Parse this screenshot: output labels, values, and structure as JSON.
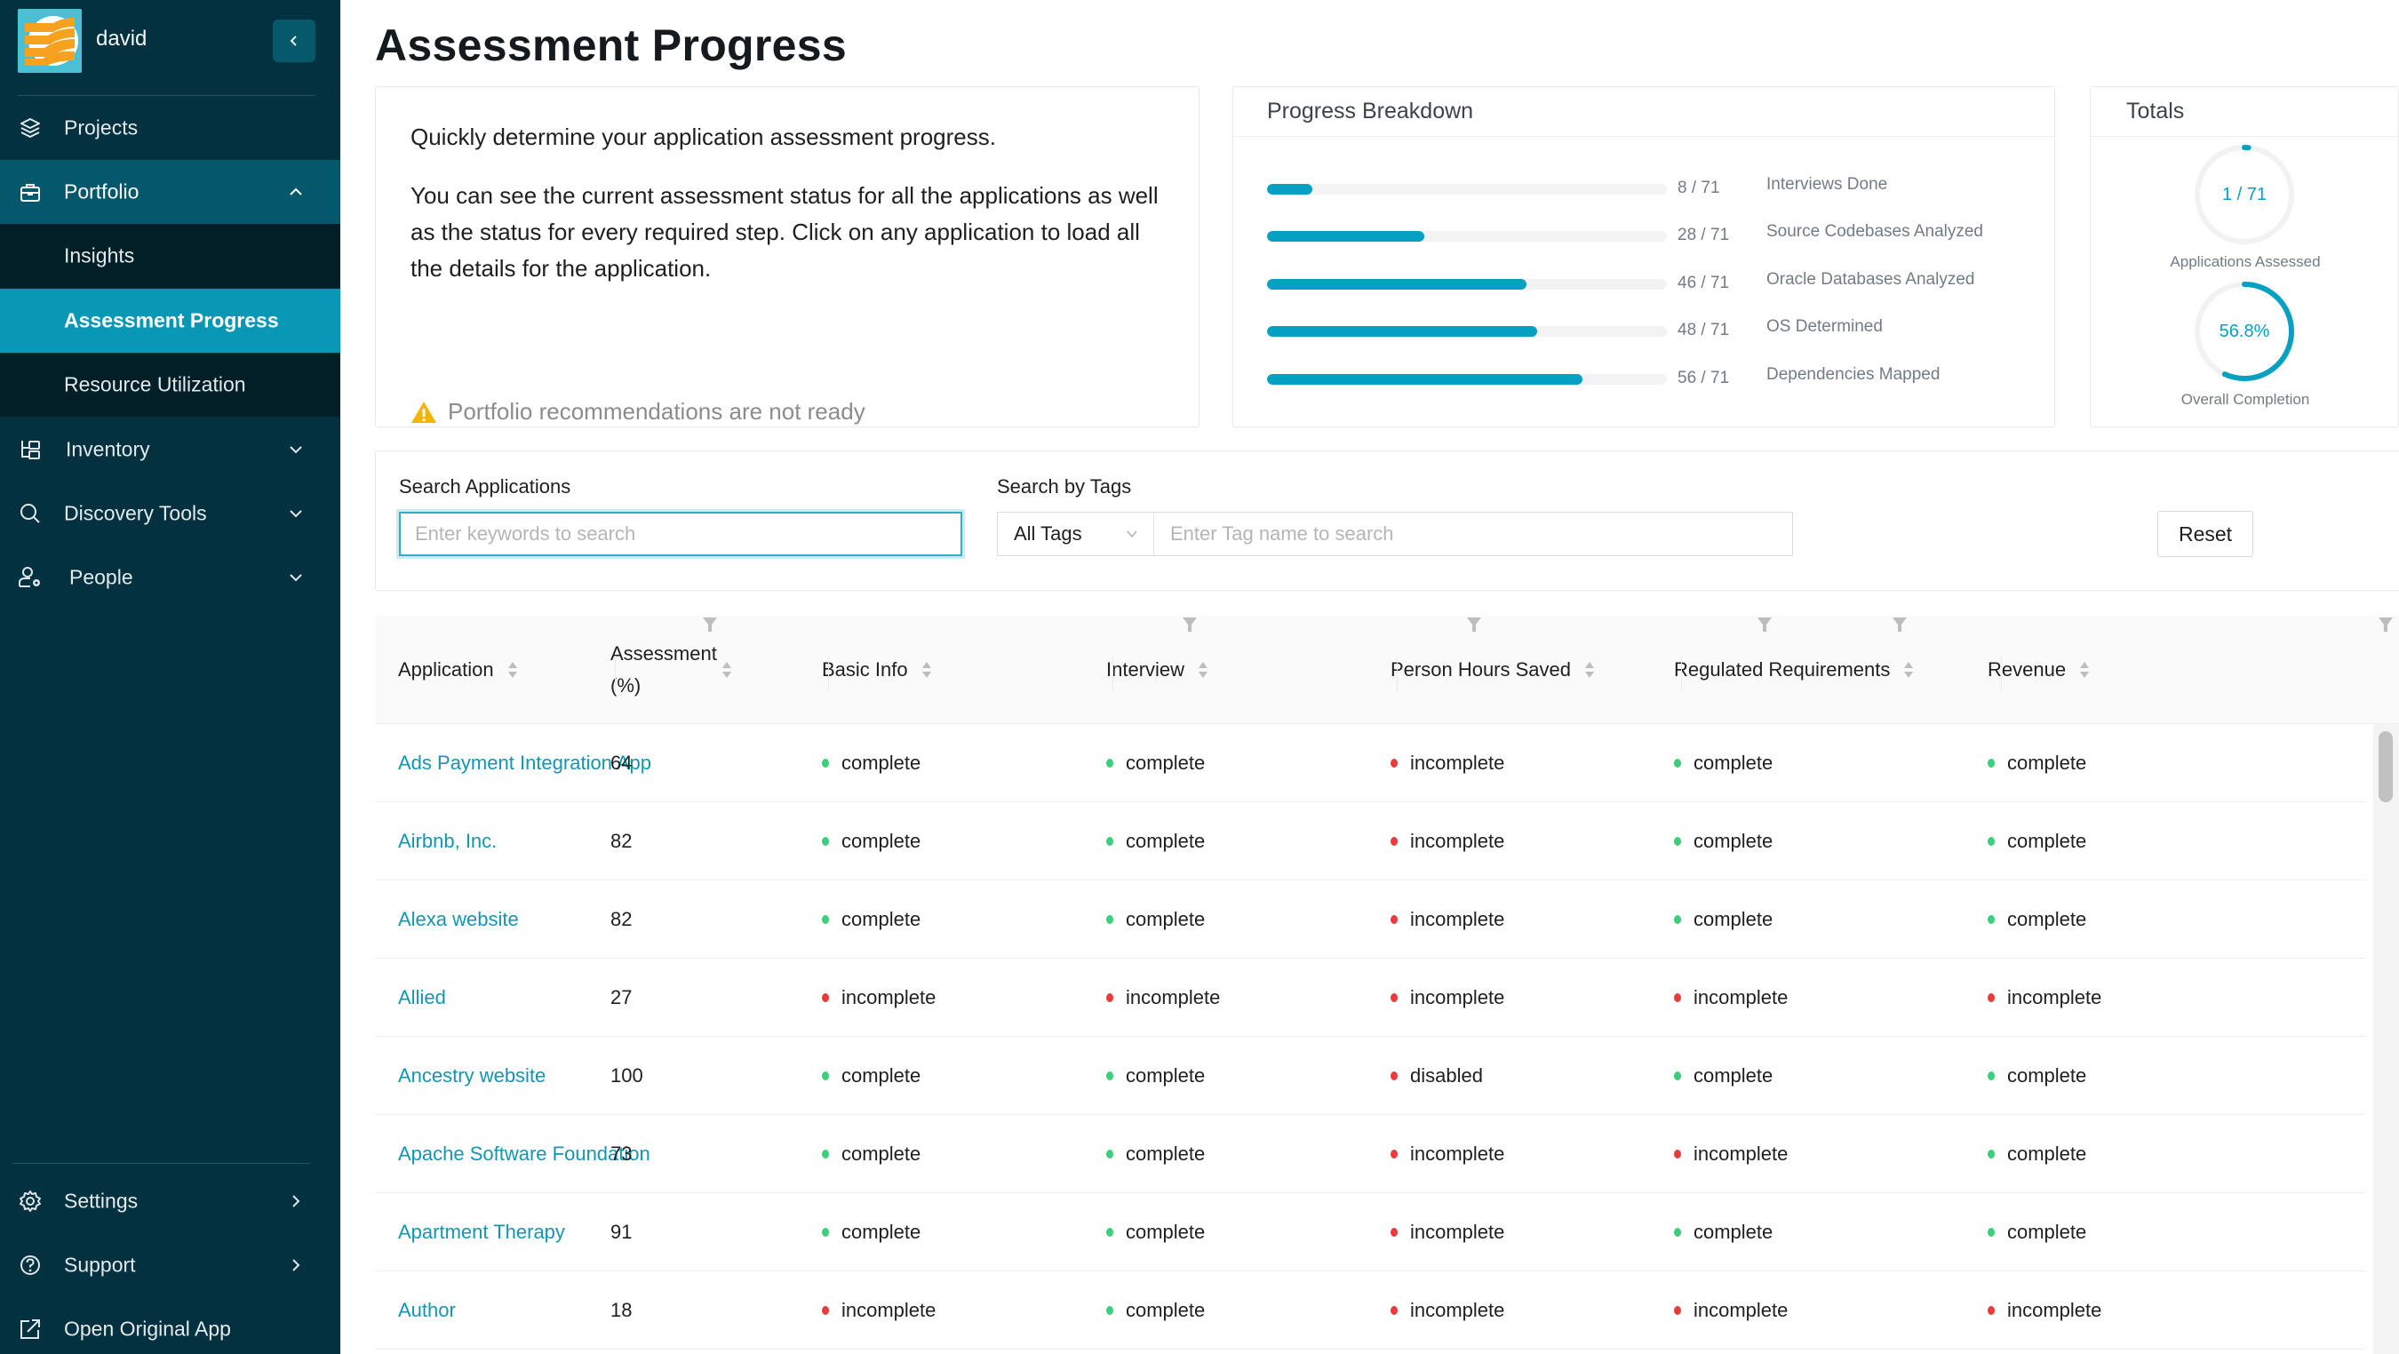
{
  "user": {
    "name": "david"
  },
  "sidebar": {
    "collapse_icon": "chevron-left-icon",
    "items": [
      {
        "label": "Projects",
        "icon": "layers-icon"
      },
      {
        "label": "Portfolio",
        "icon": "briefcase-icon",
        "expanded": true,
        "children": [
          {
            "label": "Insights"
          },
          {
            "label": "Assessment Progress",
            "active": true
          },
          {
            "label": "Resource Utilization"
          }
        ]
      },
      {
        "label": "Inventory",
        "icon": "inventory-icon"
      },
      {
        "label": "Discovery Tools",
        "icon": "search-icon"
      },
      {
        "label": "People",
        "icon": "people-settings-icon"
      }
    ],
    "bottom_items": [
      {
        "label": "Settings",
        "icon": "gear-icon"
      },
      {
        "label": "Support",
        "icon": "help-circle-icon"
      },
      {
        "label": "Open Original App",
        "icon": "external-link-icon"
      }
    ]
  },
  "page": {
    "title": "Assessment Progress",
    "description": {
      "line1": "Quickly determine your application assessment progress.",
      "line2": "You can see the current assessment status for all the applications as well as the status for every required step. Click on any application to load all the details for the application.",
      "warning": "Portfolio recommendations are not ready"
    }
  },
  "progress_breakdown": {
    "title": "Progress Breakdown",
    "total": 71,
    "items": [
      {
        "label": "Interviews Done",
        "done": 8,
        "text": "8 / 71"
      },
      {
        "label": "Source Codebases Analyzed",
        "done": 28,
        "text": "28 / 71"
      },
      {
        "label": "Oracle Databases Analyzed",
        "done": 46,
        "text": "46 / 71"
      },
      {
        "label": "OS Determined",
        "done": 48,
        "text": "48 / 71"
      },
      {
        "label": "Dependencies Mapped",
        "done": 56,
        "text": "56 / 71"
      }
    ],
    "accent": "#06a1c2"
  },
  "totals": {
    "title": "Totals",
    "applications_assessed": {
      "text": "1 / 71",
      "fraction": 0.014,
      "caption": "Applications Assessed"
    },
    "overall_completion": {
      "text": "56.8%",
      "fraction": 0.568,
      "caption": "Overall Completion"
    }
  },
  "search": {
    "apps_label": "Search Applications",
    "apps_placeholder": "Enter keywords to search",
    "apps_value": "",
    "tags_label": "Search by Tags",
    "tags_select": "All Tags",
    "tags_placeholder": "Enter Tag name to search",
    "reset_label": "Reset"
  },
  "table": {
    "columns": [
      {
        "label": "Application",
        "sortable": true,
        "filterable": true
      },
      {
        "label": "Assessment (%)",
        "sortable": true,
        "filterable": false
      },
      {
        "label": "Basic Info",
        "sortable": true,
        "filterable": true
      },
      {
        "label": "Interview",
        "sortable": true,
        "filterable": true
      },
      {
        "label": "Person Hours Saved",
        "sortable": true,
        "filterable": true
      },
      {
        "label": "Regulated Requirements",
        "sortable": true,
        "filterable": true
      },
      {
        "label": "Revenue",
        "sortable": true,
        "filterable": true
      }
    ],
    "rows": [
      {
        "app": "Ads Payment Integration App",
        "assessment": "64",
        "basic_info": "complete",
        "interview": "complete",
        "person_hours": "incomplete",
        "regulated": "complete",
        "revenue": "complete"
      },
      {
        "app": "Airbnb, Inc.",
        "assessment": "82",
        "basic_info": "complete",
        "interview": "complete",
        "person_hours": "incomplete",
        "regulated": "complete",
        "revenue": "complete"
      },
      {
        "app": "Alexa website",
        "assessment": "82",
        "basic_info": "complete",
        "interview": "complete",
        "person_hours": "incomplete",
        "regulated": "complete",
        "revenue": "complete"
      },
      {
        "app": "Allied",
        "assessment": "27",
        "basic_info": "incomplete",
        "interview": "incomplete",
        "person_hours": "incomplete",
        "regulated": "incomplete",
        "revenue": "incomplete"
      },
      {
        "app": "Ancestry website",
        "assessment": "100",
        "basic_info": "complete",
        "interview": "complete",
        "person_hours": "disabled",
        "regulated": "complete",
        "revenue": "complete"
      },
      {
        "app": "Apache Software Foundation",
        "assessment": "73",
        "basic_info": "complete",
        "interview": "complete",
        "person_hours": "incomplete",
        "regulated": "incomplete",
        "revenue": "complete"
      },
      {
        "app": "Apartment Therapy",
        "assessment": "91",
        "basic_info": "complete",
        "interview": "complete",
        "person_hours": "incomplete",
        "regulated": "complete",
        "revenue": "complete"
      },
      {
        "app": "Author",
        "assessment": "18",
        "basic_info": "incomplete",
        "interview": "complete",
        "person_hours": "incomplete",
        "regulated": "incomplete",
        "revenue": "incomplete"
      }
    ],
    "status_colors": {
      "complete": "#3ccf7a",
      "incomplete": "#e73c3c",
      "disabled": "#e73c3c"
    }
  }
}
